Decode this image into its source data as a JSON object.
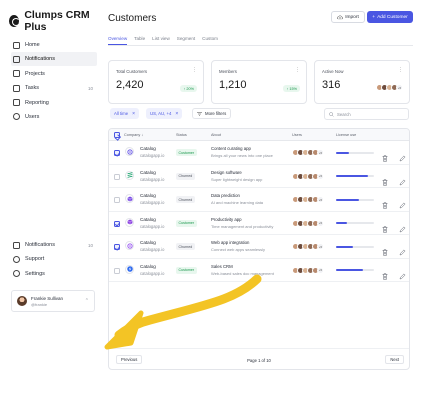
{
  "app": {
    "name": "Clumps CRM Plus"
  },
  "sidebar": {
    "items": [
      {
        "label": "Home",
        "icon": "home-icon",
        "active": false
      },
      {
        "label": "Notifications",
        "icon": "grid-icon",
        "active": true
      },
      {
        "label": "Projects",
        "icon": "layers-icon",
        "active": false
      },
      {
        "label": "Tasks",
        "icon": "check-square-icon",
        "active": false,
        "count": "10"
      },
      {
        "label": "Reporting",
        "icon": "bar-chart-icon",
        "active": false
      },
      {
        "label": "Users",
        "icon": "users-icon",
        "active": false
      }
    ],
    "bottom_items": [
      {
        "label": "Notifications",
        "icon": "bell-icon",
        "count": "10"
      },
      {
        "label": "Support",
        "icon": "life-buoy-icon"
      },
      {
        "label": "Settings",
        "icon": "gear-icon"
      }
    ],
    "user": {
      "name": "Frankie Sullivan",
      "handle": "@frankie"
    }
  },
  "header": {
    "title": "Customers",
    "import_label": "Import",
    "add_label": "Add Customer"
  },
  "tabs": [
    {
      "label": "Overview",
      "active": true
    },
    {
      "label": "Table",
      "active": false
    },
    {
      "label": "List view",
      "active": false
    },
    {
      "label": "Segment",
      "active": false
    },
    {
      "label": "Custom",
      "active": false
    }
  ],
  "stats": [
    {
      "label": "Total Customers",
      "value": "2,420",
      "trend": "20%"
    },
    {
      "label": "Members",
      "value": "1,210",
      "trend": "15%"
    },
    {
      "label": "Active Now",
      "value": "316",
      "avatars_more": "+5"
    }
  ],
  "filters": {
    "chips": [
      {
        "label": "All time"
      },
      {
        "label": "US, AU, +4"
      }
    ],
    "more_label": "More filters",
    "search_placeholder": "Search"
  },
  "table": {
    "headers": {
      "company": "Company",
      "status": "Status",
      "about": "About",
      "users": "Users",
      "license": "License use"
    },
    "rows": [
      {
        "name": "Catalog",
        "url": "catalogapp.io",
        "status": "Customer",
        "about_title": "Content curating app",
        "about_desc": "Brings all your news into one place",
        "more": "+5",
        "license": 0.35,
        "checked": true,
        "logo_color": "#6b5be6",
        "logo": "ring"
      },
      {
        "name": "Catalog",
        "url": "catalogapp.io",
        "status": "Churned",
        "about_title": "Design software",
        "about_desc": "Super lightweight design app",
        "more": "+5",
        "license": 0.85,
        "checked": false,
        "logo_color": "#17a06a",
        "logo": "stripes"
      },
      {
        "name": "Catalog",
        "url": "catalogapp.io",
        "status": "Churned",
        "about_title": "Data prediction",
        "about_desc": "AI and machine learning data",
        "more": "+5",
        "license": 0.6,
        "checked": false,
        "logo_color": "#7a4be6",
        "logo": "cube"
      },
      {
        "name": "Catalog",
        "url": "catalogapp.io",
        "status": "Customer",
        "about_title": "Productivity app",
        "about_desc": "Time management and productivity",
        "more": "+5",
        "license": 0.3,
        "checked": true,
        "logo_color": "#8a3fe0",
        "logo": "cube"
      },
      {
        "name": "Catalog",
        "url": "catalogapp.io",
        "status": "Churned",
        "about_title": "Web app integration",
        "about_desc": "Connect web apps seamlessly",
        "more": "+5",
        "license": 0.45,
        "checked": true,
        "logo_color": "#9b5cf0",
        "logo": "ring"
      },
      {
        "name": "Catalog",
        "url": "catalogapp.io",
        "status": "Customer",
        "about_title": "Sales CRM",
        "about_desc": "Web-based sales doc management",
        "more": "+5",
        "license": 0.7,
        "checked": false,
        "logo_color": "#2f6bf0",
        "logo": "bolt"
      }
    ]
  },
  "pagination": {
    "previous": "Previous",
    "page_text": "Page 1 of 10",
    "next": "Next"
  },
  "colors": {
    "accent": "#4a56e2",
    "success": "#17964a",
    "arrow": "#f3c425"
  }
}
